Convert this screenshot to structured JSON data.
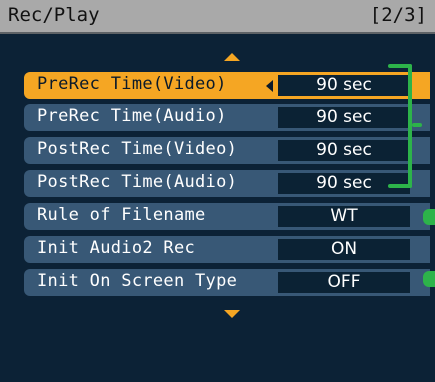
{
  "header": {
    "title": "Rec/Play",
    "page_indicator": "[2/3]"
  },
  "menu": {
    "items": [
      {
        "label": "PreRec Time(Video)",
        "value": "90 sec",
        "selected": true
      },
      {
        "label": "PreRec Time(Audio)",
        "value": "90 sec"
      },
      {
        "label": "PostRec Time(Video)",
        "value": "90 sec"
      },
      {
        "label": "PostRec Time(Audio)",
        "value": "90 sec"
      },
      {
        "label": "Rule of Filename",
        "value": "WT"
      },
      {
        "label": "Init Audio2 Rec",
        "value": "ON"
      },
      {
        "label": "Init On Screen Type",
        "value": "OFF"
      }
    ]
  },
  "colors": {
    "highlight": "#f5a623",
    "row_bg": "#385876",
    "value_bg": "#0b2234",
    "accent_green": "#2db34a",
    "title_bar": "#a9a9a9"
  },
  "icons": [
    "scroll-up-arrow-icon",
    "scroll-down-arrow-icon",
    "left-arrow-icon"
  ]
}
